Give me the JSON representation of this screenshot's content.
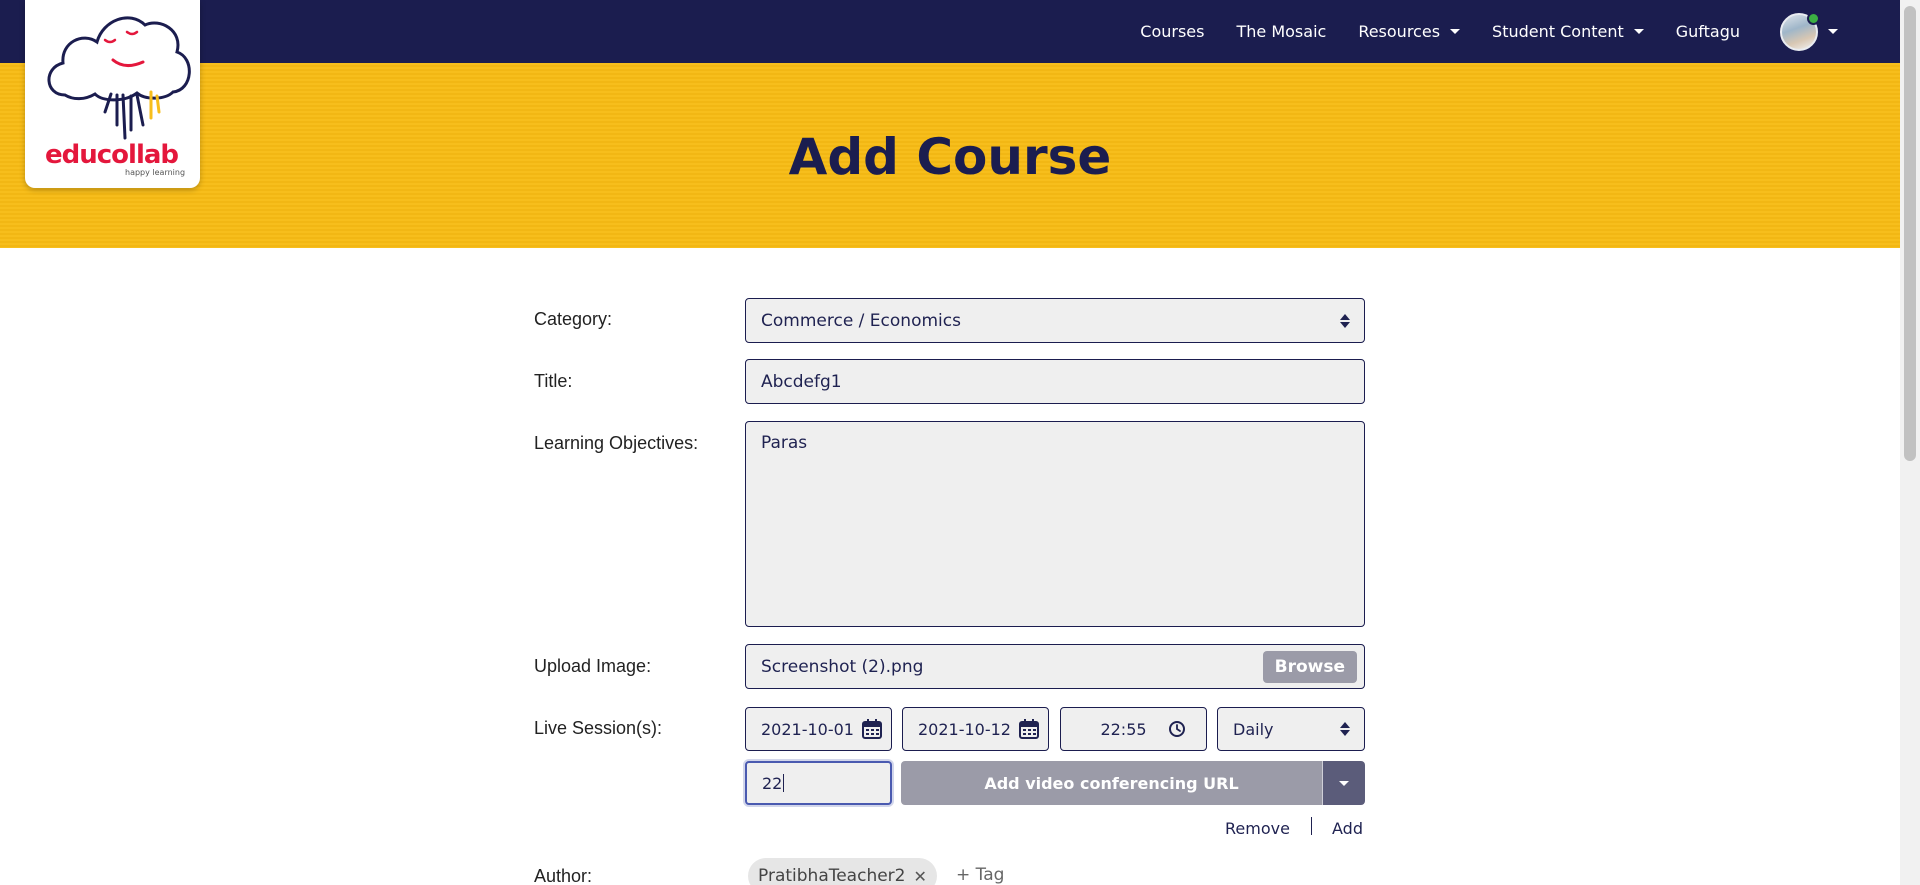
{
  "brand": {
    "name": "educollab",
    "tagline": "happy learning",
    "colors": {
      "navy": "#1b1d4f",
      "yellow": "#f7be1c",
      "red": "#e4173c"
    }
  },
  "nav": {
    "items": [
      {
        "label": "Courses",
        "dropdown": false
      },
      {
        "label": "The Mosaic",
        "dropdown": false
      },
      {
        "label": "Resources",
        "dropdown": true
      },
      {
        "label": "Student Content",
        "dropdown": true
      },
      {
        "label": "Guftagu",
        "dropdown": false
      }
    ],
    "user_online": true
  },
  "page": {
    "title": "Add Course"
  },
  "form": {
    "category": {
      "label": "Category:",
      "value": "Commerce / Economics"
    },
    "title": {
      "label": "Title:",
      "value": "Abcdefg1"
    },
    "objectives": {
      "label": "Learning Objectives:",
      "value": "Paras"
    },
    "upload": {
      "label": "Upload Image:",
      "filename": "Screenshot (2).png",
      "button": "Browse"
    },
    "live": {
      "label": "Live Session(s):",
      "start_date": "2021-10-01",
      "end_date": "2021-10-12",
      "time": "22:55",
      "frequency": "Daily",
      "duration": "22",
      "vc_button": "Add video conferencing URL",
      "remove": "Remove",
      "add": "Add"
    },
    "author": {
      "label": "Author:",
      "tag": "PratibhaTeacher2",
      "add_tag": "+ Tag"
    }
  }
}
